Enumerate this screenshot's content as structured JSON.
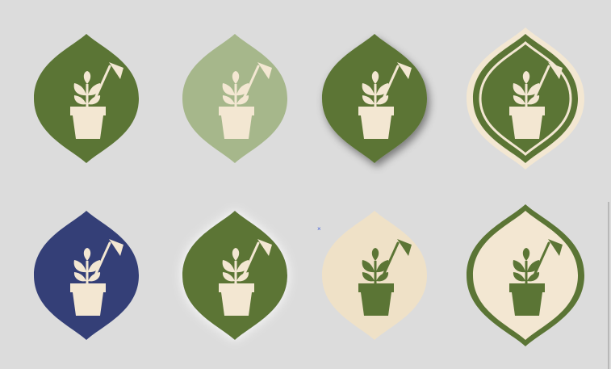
{
  "palette": {
    "background": "#dcdcdc",
    "green": "#5b7535",
    "light_green": "#a6b78b",
    "navy": "#343f77",
    "cream": "#f3e7d2",
    "pale_cream": "#efe1c7"
  },
  "icon_name": "potted-plant-with-shovel-icon",
  "badges": [
    {
      "name": "green-badge",
      "fill": "#5b7535",
      "icon_color": "#f3e7d2",
      "style": "flat"
    },
    {
      "name": "light-green-badge",
      "fill": "#a6b78b",
      "icon_color": "#f3e7d2",
      "style": "flat"
    },
    {
      "name": "green-shadow-badge",
      "fill": "#5b7535",
      "icon_color": "#f3e7d2",
      "style": "drop-shadow"
    },
    {
      "name": "green-outlined-badge",
      "fill": "#5b7535",
      "icon_color": "#f3e7d2",
      "style": "inner-outline"
    },
    {
      "name": "navy-badge",
      "fill": "#343f77",
      "icon_color": "#f3e7d2",
      "style": "flat"
    },
    {
      "name": "green-glow-badge",
      "fill": "#5b7535",
      "icon_color": "#f3e7d2",
      "style": "glow"
    },
    {
      "name": "cream-badge",
      "fill": "#efe1c7",
      "icon_color": "#5b7535",
      "style": "flat"
    },
    {
      "name": "cream-outlined-badge",
      "fill": "#f3e7d2",
      "icon_color": "#5b7535",
      "style": "outer-outline"
    }
  ],
  "cursor_glyph": "×"
}
